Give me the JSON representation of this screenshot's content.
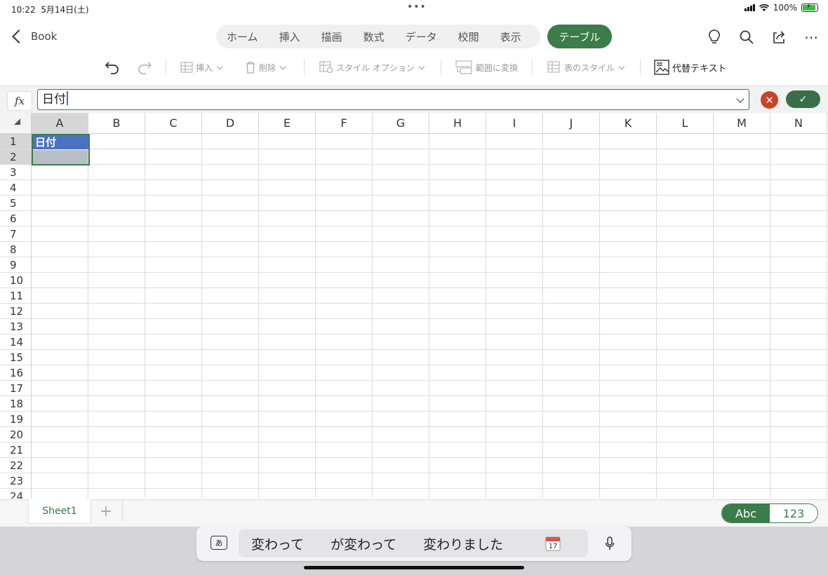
{
  "status": {
    "time": "10:22",
    "date": "5月14日(土)",
    "dots": "•••",
    "battery": "100%"
  },
  "header": {
    "back_label": "Book",
    "tabs": [
      "ホーム",
      "挿入",
      "描画",
      "数式",
      "データ",
      "校閲",
      "表示"
    ],
    "active_tab": "テーブル"
  },
  "toolbar": {
    "insert": "挿入",
    "delete": "削除",
    "style_options": "スタイル オプション",
    "convert_range": "範囲に変換",
    "table_styles": "表のスタイル",
    "alt_text": "代替テキスト"
  },
  "formula_bar": {
    "fx": "fx",
    "value": "日付"
  },
  "grid": {
    "columns": [
      "A",
      "B",
      "C",
      "D",
      "E",
      "F",
      "G",
      "H",
      "I",
      "J",
      "K",
      "L",
      "M",
      "N"
    ],
    "rows": [
      "1",
      "2",
      "3",
      "4",
      "5",
      "6",
      "7",
      "8",
      "9",
      "10",
      "11",
      "12",
      "13",
      "14",
      "15",
      "16",
      "17",
      "18",
      "19",
      "20",
      "21",
      "22",
      "23",
      "24"
    ],
    "cell_a1": "日付",
    "selected_column": "A",
    "selected_rows": [
      "1",
      "2"
    ]
  },
  "sheets": {
    "active": "Sheet1",
    "add": "+"
  },
  "keyboard_toggle": {
    "abc": "Abc",
    "num": "123"
  },
  "suggestions": {
    "kana_key": "あ",
    "items": [
      "変わって",
      "が変わって",
      "変わりました"
    ],
    "calendar_day": "17"
  },
  "colors": {
    "accent": "#3a7d48",
    "selection": "#4a72c4",
    "cancel": "#c9422a"
  }
}
